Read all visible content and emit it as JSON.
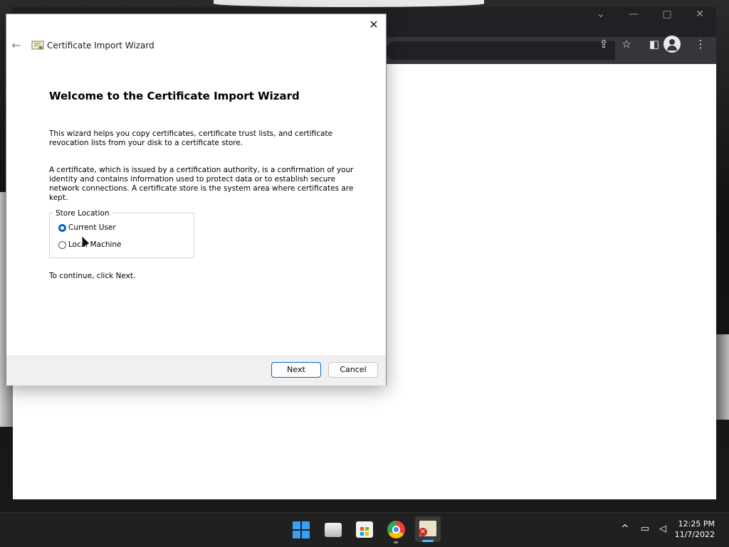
{
  "dialog": {
    "title": "Certificate Import Wizard",
    "close_glyph": "✕",
    "back_glyph": "←",
    "heading": "Welcome to the Certificate Import Wizard",
    "paragraph1": "This wizard helps you copy certificates, certificate trust lists, and certificate revocation lists from your disk to a certificate store.",
    "paragraph2": "A certificate, which is issued by a certification authority, is a confirmation of your identity and contains information used to protect data or to establish secure network connections. A certificate store is the system area where certificates are kept.",
    "store_location": {
      "legend": "Store Location",
      "options": [
        {
          "label": "Current User",
          "selected": true
        },
        {
          "label": "Local Machine",
          "selected": false
        }
      ]
    },
    "continue_text": "To continue, click Next.",
    "buttons": {
      "next": "Next",
      "cancel": "Cancel"
    }
  },
  "browser": {
    "window_controls": {
      "tabs": "⌄",
      "minimize": "—",
      "maximize": "▢",
      "close": "✕"
    },
    "toolbar_icons": [
      "share-icon",
      "star-icon",
      "side-panel-icon",
      "profile-icon",
      "menu-icon"
    ],
    "toolbar_glyphs": {
      "share": "⇪",
      "star": "☆",
      "side_panel": "◧",
      "menu": "⋮"
    }
  },
  "taskbar": {
    "apps": [
      "start-icon",
      "file-explorer-icon",
      "store-icon",
      "chrome-icon",
      "certificate-manager-icon"
    ],
    "tray_glyphs": {
      "chevron": "^",
      "network": "▭",
      "volume": "◁"
    },
    "clock": {
      "time": "12:25 PM",
      "date": "11/7/2022"
    }
  },
  "colors": {
    "accent": "#0067c0",
    "taskbar": "#202020",
    "browser_frame": "#202124",
    "running_indicator": "#4cc2ff"
  }
}
